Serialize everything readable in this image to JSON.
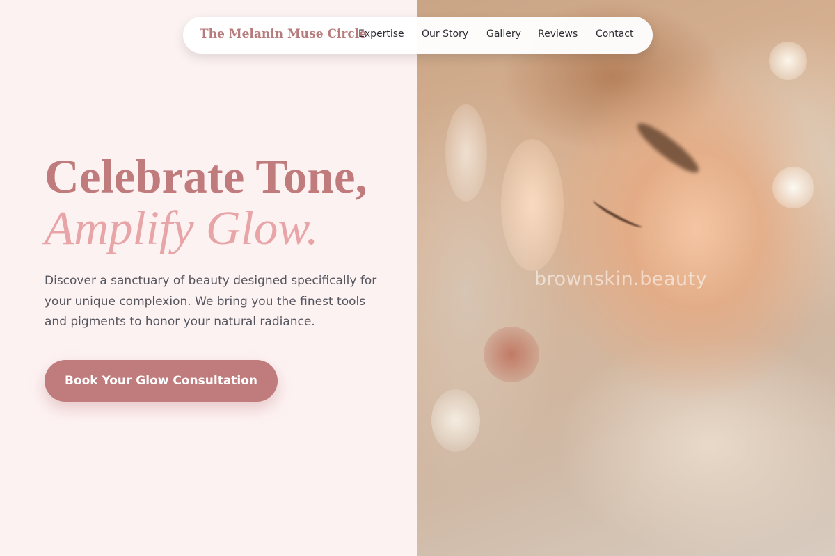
{
  "nav": {
    "brand": "The Melanin Muse Circle",
    "links": [
      "Expertise",
      "Our Story",
      "Gallery",
      "Reviews",
      "Contact"
    ]
  },
  "hero": {
    "headline_line1": "Celebrate Tone,",
    "headline_line2": "Amplify Glow.",
    "description": "Discover a sanctuary of beauty designed specifically for your unique complexion. We bring you the finest tools and pigments to honor your natural radiance.",
    "cta_label": "Book Your Glow Consultation"
  },
  "image": {
    "watermark": "brownskin.beauty",
    "subject": "close-up portrait with closed eyes in soft warm light"
  },
  "colors": {
    "background": "#fdf2f2",
    "accent": "#c07b7c",
    "accent_light": "#e8a5a8",
    "body_text": "#55555e",
    "nav_text": "#2d2d35"
  }
}
